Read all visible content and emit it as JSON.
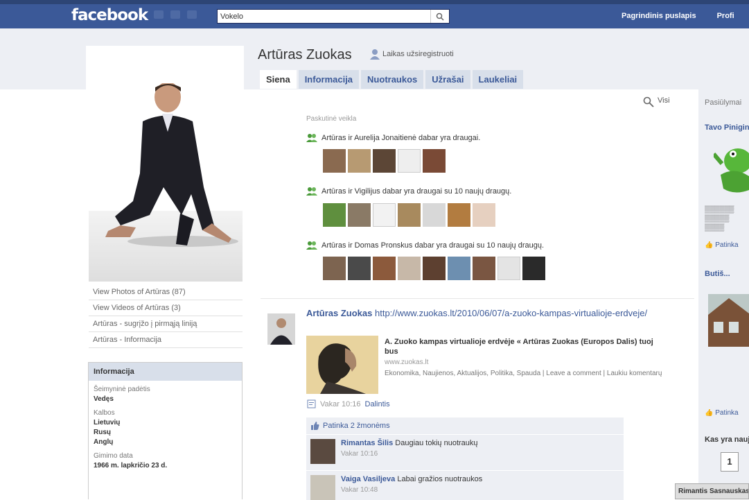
{
  "app": {
    "logo": "facebook"
  },
  "search": {
    "value": "Vokelo"
  },
  "top_nav": {
    "home": "Pagrindinis puslapis",
    "profile": "Profi"
  },
  "profile": {
    "name": "Artūras Zuokas",
    "subscribe": "Laikas užsiregistruoti",
    "tabs": [
      "Siena",
      "Informacija",
      "Nuotraukos",
      "Užrašai",
      "Laukeliai"
    ],
    "active_tab": 0
  },
  "left_links": [
    "View Photos of Artūras (87)",
    "View Videos of Artūras (3)",
    "Artūras - sugrįžo į pirmąją liniją",
    "Artūras - Informacija"
  ],
  "info_box": {
    "title": "Informacija",
    "rows": [
      {
        "label": "Šeimyninė padėtis",
        "value": "Vedęs"
      },
      {
        "label": "Kalbos",
        "value": "Lietuvių"
      },
      {
        "label": "",
        "value": "Rusų"
      },
      {
        "label": "",
        "value": "Anglų"
      },
      {
        "label": "Gimimo data",
        "value": "1966 m. lapkričio 23 d."
      }
    ]
  },
  "wall": {
    "filter": "Visi",
    "recent_label": "Paskutinė veikla",
    "activities": [
      "Artūras ir Aurelija Jonaitienė dabar yra draugai.",
      "Artūras ir Vigilijus dabar yra draugai su 10 naujų draugų.",
      "Artūras ir Domas Pronskus dabar yra draugai su 10 naujų draugų."
    ]
  },
  "post": {
    "author": "Artūras Zuokas",
    "url": "http://www.zuokas.lt/2010/06/07/a-zuoko-kampas-virtualioje-erdveje/",
    "link_title": "A. Zuoko kampas virtualioje erdvėje « Artūras Zuokas (Europos Dalis) tuoj bus",
    "link_domain": "www.zuokas.lt",
    "link_desc": "Ekonomika, Naujienos, Aktualijos, Politika, Spauda | Leave a comment | Laukiu komentarų",
    "meta_time": "Vakar 10:16",
    "meta_action": "Dalintis",
    "likes": "Patinka 2 žmonėms",
    "comments": [
      {
        "author": "Rimantas Šilis",
        "text": "Daugiau tokių nuotraukų",
        "time": "Vakar 10:16"
      },
      {
        "author": "Vaiga Vasiljeva",
        "text": "Labai gražios nuotraukos",
        "time": "Vakar 10:48"
      }
    ]
  },
  "right_column": {
    "heads": [
      "Pasiūlymai",
      "Tavo Piniginė",
      "Kas yra naujo"
    ],
    "likes_label": "Patinka",
    "chat_chip": "Rimantis Sasnauskas"
  }
}
